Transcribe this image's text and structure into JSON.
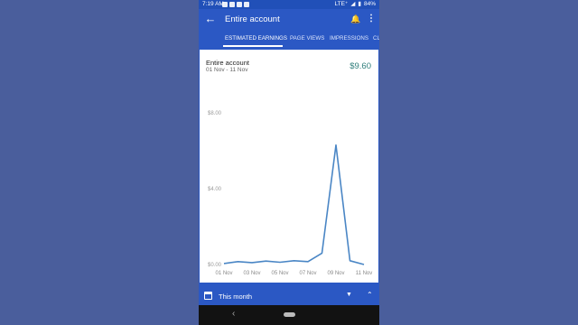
{
  "status": {
    "time": "7:19 AM",
    "right_text": "LTE⁺",
    "battery": "84%"
  },
  "appbar": {
    "title": "Entire account",
    "back_icon": "arrow-back-icon",
    "notify_icon": "bell-icon",
    "more_icon": "more-vert-icon"
  },
  "tabs": [
    {
      "label": "ESTIMATED EARNINGS",
      "active": true
    },
    {
      "label": "PAGE VIEWS",
      "active": false
    },
    {
      "label": "IMPRESSIONS",
      "active": false
    },
    {
      "label": "CL",
      "active": false
    }
  ],
  "card": {
    "title": "Entire account",
    "range": "01 Nov - 11 Nov",
    "total": "$9.60"
  },
  "chart_data": {
    "type": "line",
    "x": [
      "01 Nov",
      "02 Nov",
      "03 Nov",
      "04 Nov",
      "05 Nov",
      "06 Nov",
      "07 Nov",
      "08 Nov",
      "09 Nov",
      "10 Nov",
      "11 Nov"
    ],
    "xtick_labels": [
      "01 Nov",
      "03 Nov",
      "05 Nov",
      "07 Nov",
      "09 Nov",
      "11 Nov"
    ],
    "series": [
      {
        "values": [
          0.05,
          0.15,
          0.1,
          0.18,
          0.12,
          0.2,
          0.15,
          0.6,
          6.3,
          0.2,
          0.0
        ]
      }
    ],
    "ytick_labels": [
      "$8.00",
      "$4.00",
      "$0.00"
    ],
    "yticks": [
      8,
      4,
      0
    ],
    "ylim": [
      0,
      8
    ],
    "line_color": "#4a86c5",
    "grid": false
  },
  "bottombar": {
    "label": "This month",
    "calendar_icon": "calendar-icon",
    "dropdown_icon": "caret-down-icon",
    "collapse_icon": "chevron-up-icon"
  }
}
